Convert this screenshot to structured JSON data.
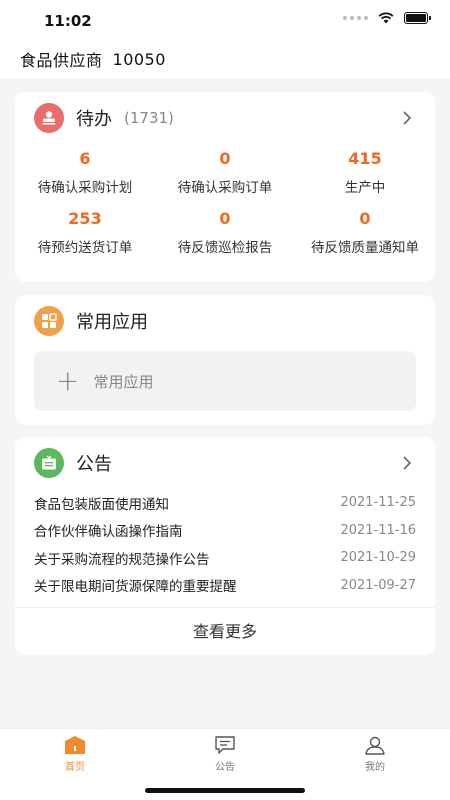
{
  "status_bar": {
    "time": "11:02"
  },
  "header": {
    "company": "食品供应商",
    "code": "10050"
  },
  "todo": {
    "title": "待办",
    "count": "(1731)",
    "items": [
      {
        "value": "6",
        "label": "待确认采购计划"
      },
      {
        "value": "0",
        "label": "待确认采购订单"
      },
      {
        "value": "415",
        "label": "生产中"
      },
      {
        "value": "253",
        "label": "待预约送货订单"
      },
      {
        "value": "0",
        "label": "待反馈巡检报告"
      },
      {
        "value": "0",
        "label": "待反馈质量通知单"
      }
    ]
  },
  "apps": {
    "title": "常用应用",
    "add_label": "常用应用"
  },
  "notices": {
    "title": "公告",
    "items": [
      {
        "title": "食品包装版面使用通知",
        "date": "2021-11-25"
      },
      {
        "title": "合作伙伴确认函操作指南",
        "date": "2021-11-16"
      },
      {
        "title": "关于采购流程的规范操作公告",
        "date": "2021-10-29"
      },
      {
        "title": "关于限电期间货源保障的重要提醒",
        "date": "2021-09-27"
      }
    ],
    "more_label": "查看更多"
  },
  "tabbar": {
    "tabs": [
      {
        "label": "首页",
        "icon": "home-icon",
        "active": true
      },
      {
        "label": "公告",
        "icon": "message-icon",
        "active": false
      },
      {
        "label": "我的",
        "icon": "user-icon",
        "active": false
      }
    ]
  },
  "colors": {
    "accent": "#ef6a1e",
    "todo_icon": "#ec6b6b",
    "apps_icon": "#f0a04b",
    "notice_icon": "#5cb85c",
    "tab_active": "#f08a2c"
  }
}
